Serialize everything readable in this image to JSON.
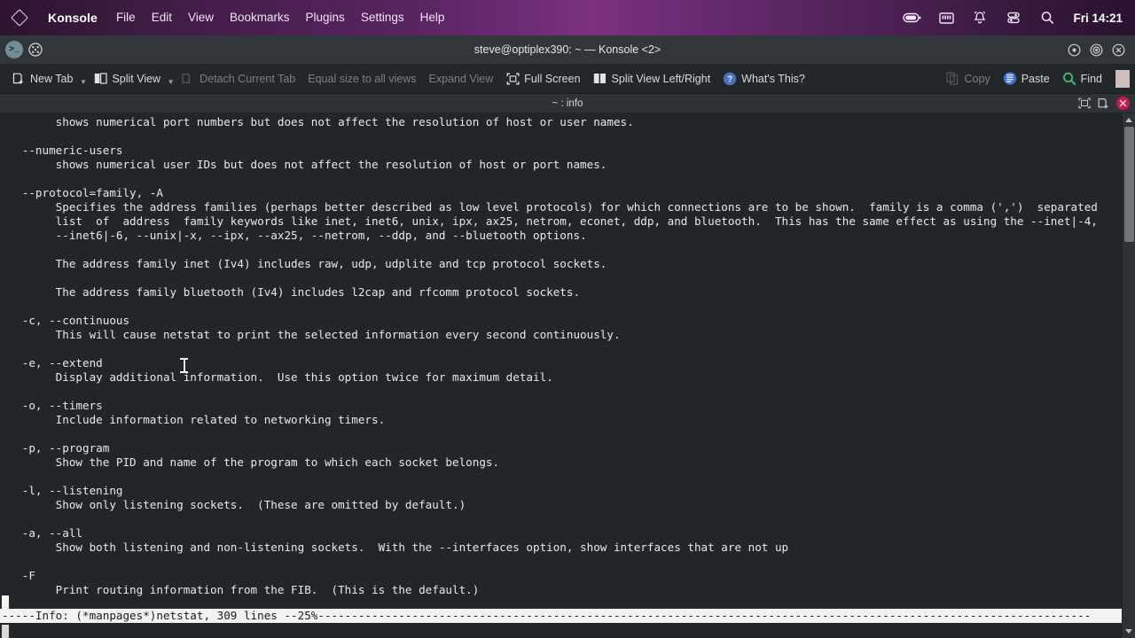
{
  "global_panel": {
    "logo_icon": "kde-diamond-icon",
    "app_name": "Konsole",
    "menus": [
      "File",
      "Edit",
      "View",
      "Bookmarks",
      "Plugins",
      "Settings",
      "Help"
    ],
    "tray_icons": [
      "battery-icon",
      "network-icon",
      "notifications-bell-icon",
      "audio-sliders-icon",
      "search-icon"
    ],
    "clock": "Fri 14:21",
    "accent_color": "#7a3180"
  },
  "window": {
    "app_icon": "terminal-prompt-icon",
    "grid_icon": "app-grid-icon",
    "title": "steve@optiplex390: ~ — Konsole <2>",
    "controls": [
      "minimize-button",
      "maximize-button",
      "close-button"
    ]
  },
  "toolbar": {
    "items": [
      {
        "label": "New Tab",
        "icon": "new-tab-icon",
        "disabled": false,
        "caret": true
      },
      {
        "label": "Split View",
        "icon": "split-view-icon",
        "disabled": false,
        "caret": true
      },
      {
        "label": "Detach Current Tab",
        "icon": "detach-tab-icon",
        "disabled": true,
        "caret": false
      },
      {
        "label": "Equal size to all views",
        "icon": "",
        "disabled": true,
        "caret": false
      },
      {
        "label": "Expand View",
        "icon": "",
        "disabled": true,
        "caret": false
      },
      {
        "label": "Full Screen",
        "icon": "fullscreen-icon",
        "disabled": false,
        "caret": false
      },
      {
        "label": "Split View Left/Right",
        "icon": "split-left-right-icon",
        "disabled": false,
        "caret": false
      },
      {
        "label": "What's This?",
        "icon": "whats-this-help-icon",
        "disabled": false,
        "caret": false
      }
    ],
    "right_items": [
      {
        "label": "Copy",
        "icon": "copy-icon",
        "disabled": true
      },
      {
        "label": "Paste",
        "icon": "paste-icon",
        "disabled": false
      },
      {
        "label": "Find",
        "icon": "find-magnifier-icon",
        "disabled": false
      }
    ],
    "swatch_color": "#cdc0b8"
  },
  "tabbar": {
    "tab_label": "~ : info",
    "right_icons": [
      "resize-frame-icon",
      "new-tab-icon",
      "close-tab-icon"
    ],
    "close_color": "#c9184a"
  },
  "terminal": {
    "background": "#232629",
    "foreground": "#e8e8e8",
    "lines": [
      "        shows numerical port numbers but does not affect the resolution of host or user names.",
      "",
      "   --numeric-users",
      "        shows numerical user IDs but does not affect the resolution of host or port names.",
      "",
      "   --protocol=family, -A",
      "        Specifies the address families (perhaps better described as low level protocols) for which connections are to be shown.  family is a comma (',')  separated",
      "        list  of  address  family keywords like inet, inet6, unix, ipx, ax25, netrom, econet, ddp, and bluetooth.  This has the same effect as using the --inet|-4,",
      "        --inet6|-6, --unix|-x, --ipx, --ax25, --netrom, --ddp, and --bluetooth options.",
      "",
      "        The address family inet (Iv4) includes raw, udp, udplite and tcp protocol sockets.",
      "",
      "        The address family bluetooth (Iv4) includes l2cap and rfcomm protocol sockets.",
      "",
      "   -c, --continuous",
      "        This will cause netstat to print the selected information every second continuously.",
      "",
      "   -e, --extend",
      "        Display additional information.  Use this option twice for maximum detail.",
      "",
      "   -o, --timers",
      "        Include information related to networking timers.",
      "",
      "   -p, --program",
      "        Show the PID and name of the program to which each socket belongs.",
      "",
      "   -l, --listening",
      "        Show only listening sockets.  (These are omitted by default.)",
      "",
      "   -a, --all",
      "        Show both listening and non-listening sockets.  With the --interfaces option, show interfaces that are not up",
      "",
      "   -F",
      "        Print routing information from the FIB.  (This is the default.)"
    ],
    "status_line": "-----Info: (*manpages*)netstat, 309 lines --25%-------------------------------------------------------------------------------------------------------------------",
    "status_bg": "#f2f2f2",
    "status_fg": "#1b1b1b",
    "cursor": "block-cursor",
    "mouse_pointer": "text-ibeam-cursor"
  },
  "scrollbar": {
    "up_arrow": "scroll-up-arrow",
    "down_arrow": "scroll-down-arrow",
    "thumb": "scrollbar-thumb"
  }
}
